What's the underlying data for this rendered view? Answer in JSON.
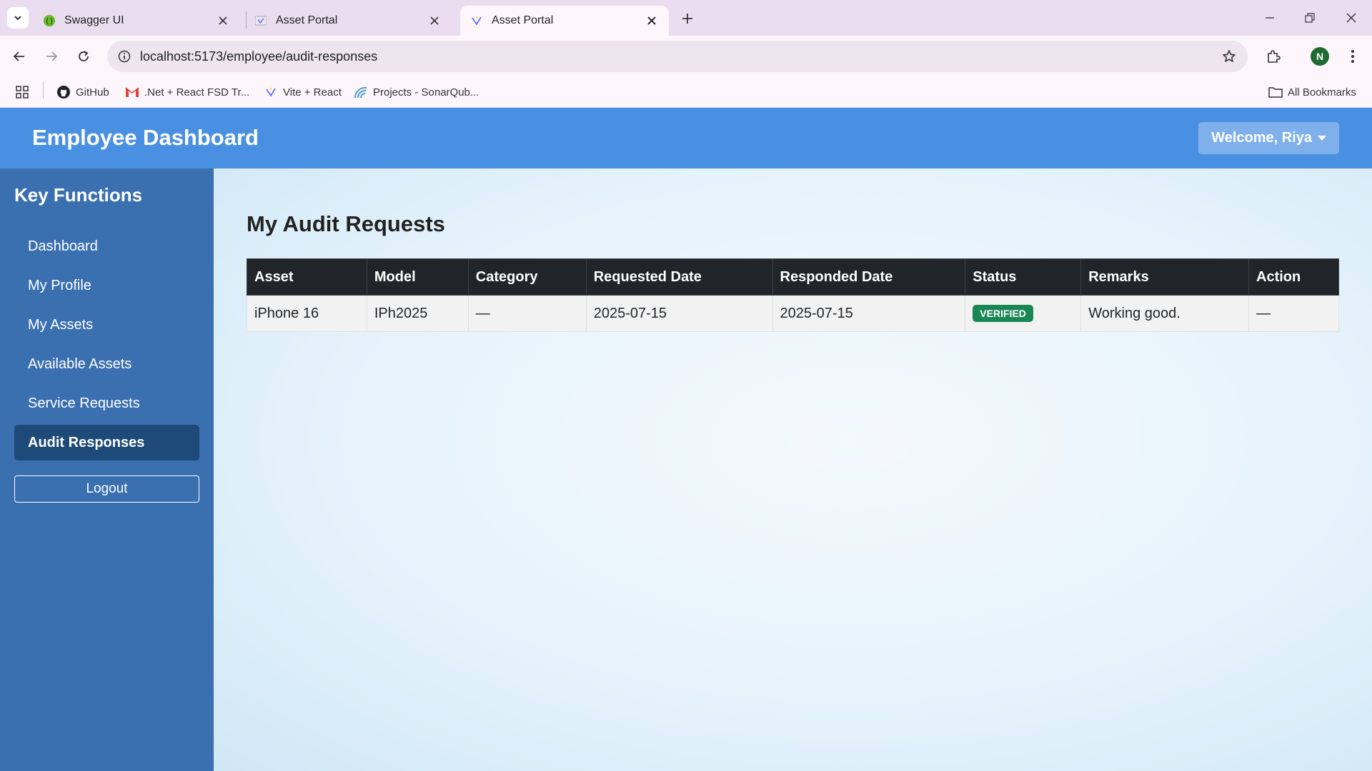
{
  "browser": {
    "tabs": [
      {
        "title": "Swagger UI",
        "active": false
      },
      {
        "title": "Asset Portal",
        "active": false
      },
      {
        "title": "Asset Portal",
        "active": true
      }
    ],
    "url": "localhost:5173/employee/audit-responses",
    "profile_initial": "N",
    "bookmarks": [
      {
        "label": "GitHub",
        "icon": "github-icon"
      },
      {
        "label": ".Net + React FSD Tr...",
        "icon": "gmail-icon"
      },
      {
        "label": "Vite + React",
        "icon": "vite-icon"
      },
      {
        "label": "Projects - SonarQub...",
        "icon": "sonarqube-icon"
      }
    ],
    "all_bookmarks": "All Bookmarks"
  },
  "header": {
    "title": "Employee Dashboard",
    "welcome": "Welcome, Riya"
  },
  "sidebar": {
    "title": "Key Functions",
    "items": [
      {
        "label": "Dashboard",
        "active": false
      },
      {
        "label": "My Profile",
        "active": false
      },
      {
        "label": "My Assets",
        "active": false
      },
      {
        "label": "Available Assets",
        "active": false
      },
      {
        "label": "Service Requests",
        "active": false
      },
      {
        "label": "Audit Responses",
        "active": true
      }
    ],
    "logout": "Logout"
  },
  "main": {
    "title": "My Audit Requests",
    "columns": [
      "Asset",
      "Model",
      "Category",
      "Requested Date",
      "Responded Date",
      "Status",
      "Remarks",
      "Action"
    ],
    "rows": [
      {
        "asset": "iPhone 16",
        "model": "IPh2025",
        "category": "—",
        "requested_date": "2025-07-15",
        "responded_date": "2025-07-15",
        "status": "VERIFIED",
        "remarks": "Working good.",
        "action": "—"
      }
    ]
  },
  "colors": {
    "header_bg": "#4a90e2",
    "sidebar_bg": "#3a6fb0",
    "sidebar_active": "#1d4a78",
    "table_head": "#212529",
    "status_verified": "#198754"
  }
}
